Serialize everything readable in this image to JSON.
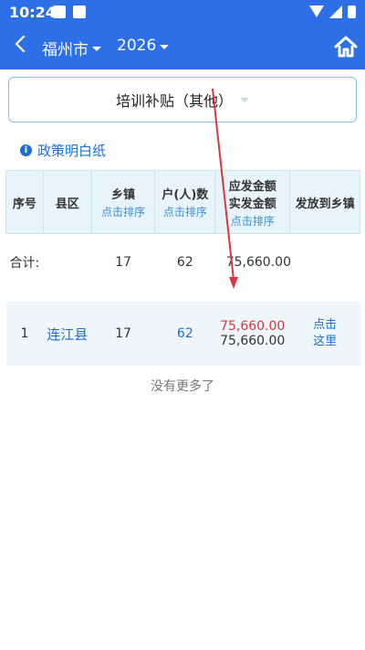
{
  "status": {
    "time": "10:24"
  },
  "header": {
    "back_icon": "chevron-left-icon",
    "city": "福州市",
    "year": "2026",
    "home_icon": "home-icon"
  },
  "category": {
    "selected": "培训补贴（其他）"
  },
  "policy": {
    "label": "政策明白纸"
  },
  "table": {
    "headers": {
      "index": "序号",
      "county": "县区",
      "town": "乡镇",
      "town_sort": "点击排序",
      "household": "户(人)数",
      "household_sort": "点击排序",
      "amount_due": "应发金额",
      "amount_actual": "实发金额",
      "amount_sort": "点击排序",
      "distribute": "发放到乡镇"
    },
    "total": {
      "label": "合计:",
      "town_count": "17",
      "household_count": "62",
      "amount": "75,660.00"
    },
    "rows": [
      {
        "index": "1",
        "county": "连江县",
        "town_count": "17",
        "household_count": "62",
        "amount_due": "75,660.00",
        "amount_actual": "75,660.00",
        "action": "点击这里"
      }
    ]
  },
  "footer": {
    "no_more": "没有更多了"
  },
  "colors": {
    "primary": "#2d6fe6",
    "link": "#1f6fd0",
    "alert_red": "#d9363e",
    "header_bg": "#e8f4fb"
  }
}
